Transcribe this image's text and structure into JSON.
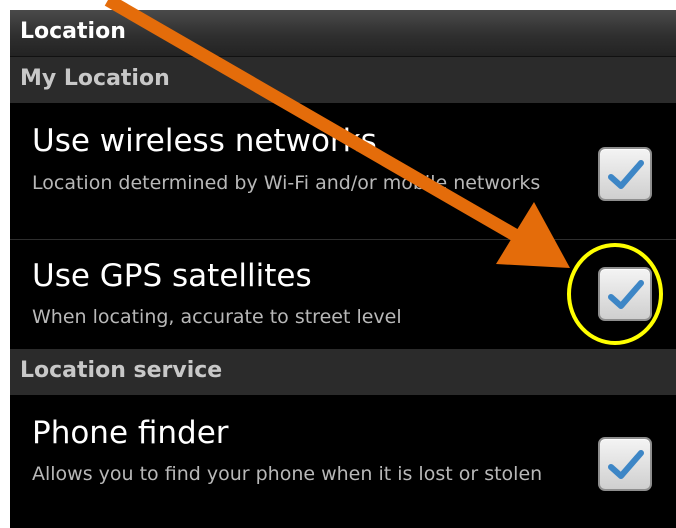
{
  "screen": {
    "title": "Location"
  },
  "sections": [
    {
      "header": "My Location"
    },
    {
      "header": "Location service"
    }
  ],
  "preferences": [
    {
      "title": "Use wireless networks",
      "summary": "Location determined by Wi-Fi and/or mobile networks",
      "checked": true
    },
    {
      "title": "Use GPS satellites",
      "summary": "When locating, accurate to street level",
      "checked": true
    },
    {
      "title": "Phone finder",
      "summary": "Allows you to find your phone when it is lost or stolen",
      "checked": true
    }
  ],
  "colors": {
    "checkmark": "#3d86c6",
    "arrow": "#e46c0a",
    "highlight_circle": "#ffff00"
  }
}
